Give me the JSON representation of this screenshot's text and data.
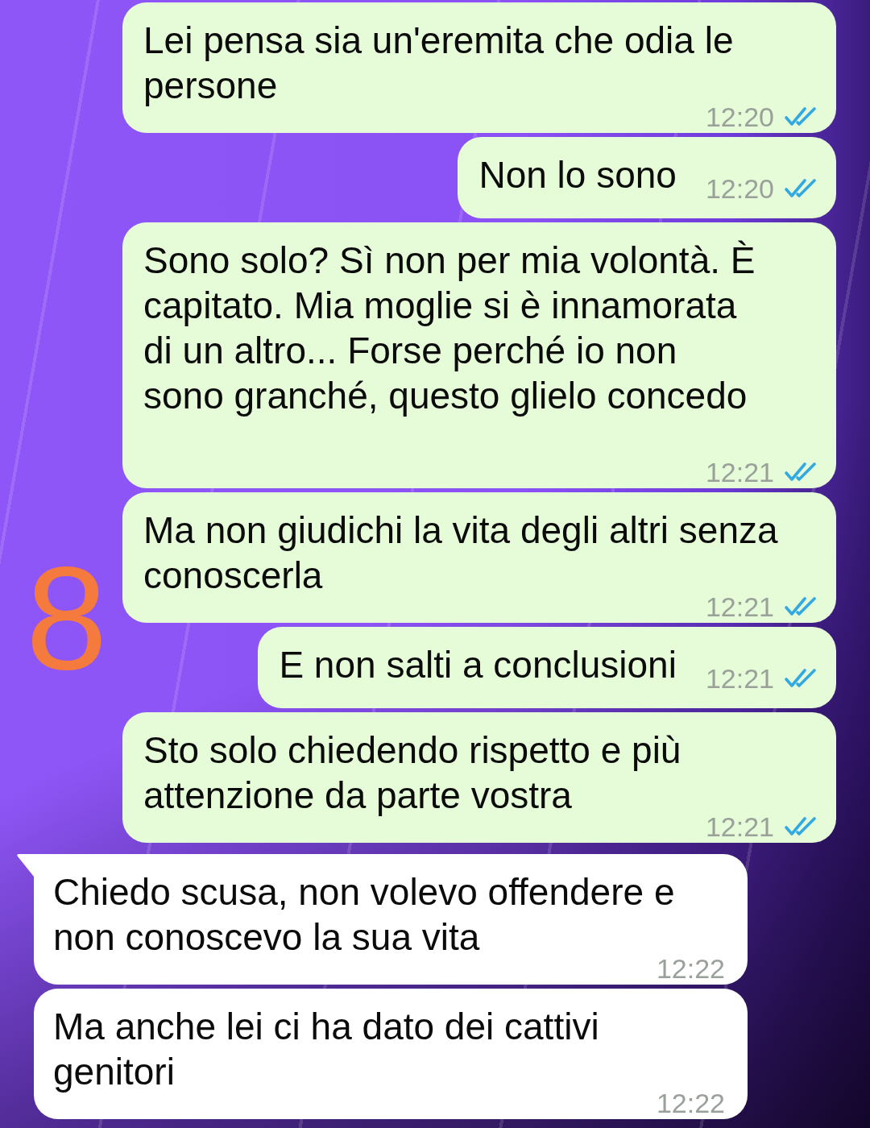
{
  "messages": [
    {
      "kind": "outgoing",
      "tail": false,
      "lines": [
        "Lei pensa sia un'eremita che odia le",
        "persone"
      ],
      "time": "12:20",
      "read": true
    },
    {
      "kind": "outgoing",
      "tail": false,
      "lines": [
        "Non lo sono"
      ],
      "time": "12:20",
      "read": true
    },
    {
      "kind": "outgoing",
      "tail": false,
      "lines": [
        "Sono solo? Sì non per mia volontà. È",
        "capitato. Mia moglie si è innamorata",
        "di un altro... Forse perché io non",
        "sono granché, questo glielo concedo"
      ],
      "time": "12:21",
      "read": true
    },
    {
      "kind": "outgoing",
      "tail": false,
      "lines": [
        "Ma non giudichi la vita degli altri senza",
        "conoscerla"
      ],
      "time": "12:21",
      "read": true
    },
    {
      "kind": "outgoing",
      "tail": false,
      "lines": [
        "E non salti a conclusioni"
      ],
      "time": "12:21",
      "read": true
    },
    {
      "kind": "outgoing",
      "tail": false,
      "lines": [
        "Sto solo chiedendo rispetto e più",
        "attenzione da parte vostra"
      ],
      "time": "12:21",
      "read": true
    },
    {
      "kind": "incoming",
      "tail": true,
      "lines": [
        "Chiedo scusa, non volevo offendere e",
        "non conoscevo la sua vita"
      ],
      "time": "12:22"
    },
    {
      "kind": "incoming",
      "tail": false,
      "lines": [
        "Ma anche lei ci ha dato dei cattivi",
        "genitori"
      ],
      "time": "12:22"
    }
  ],
  "annotation": "8"
}
